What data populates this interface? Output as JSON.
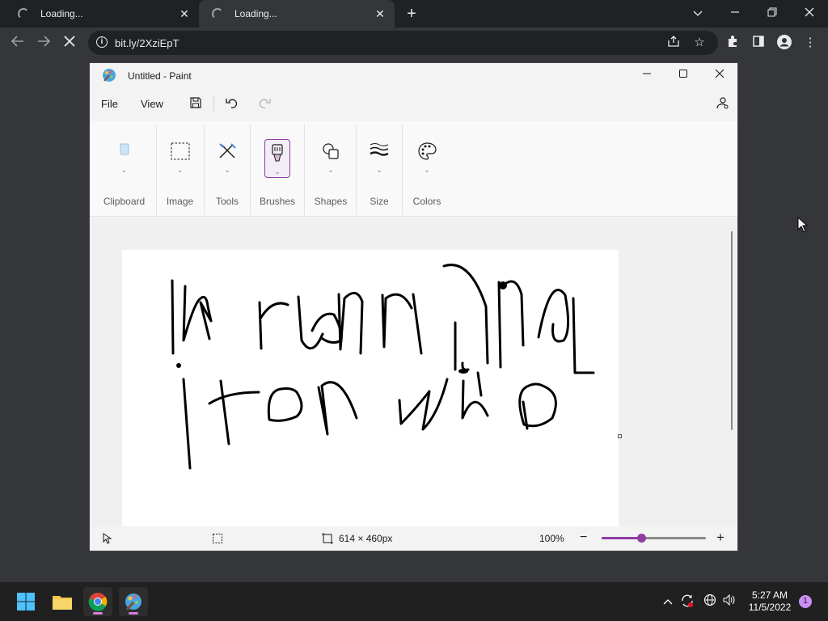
{
  "browser": {
    "tabs": [
      {
        "title": "Loading...",
        "active": false
      },
      {
        "title": "Loading...",
        "active": true
      }
    ],
    "url": "bit.ly/2XziEpT",
    "info_icon": "i"
  },
  "paint": {
    "title": "Untitled - Paint",
    "menu": {
      "file": "File",
      "view": "View"
    },
    "ribbon_groups": [
      "Clipboard",
      "Image",
      "Tools",
      "Brushes",
      "Shapes",
      "Size",
      "Colors"
    ],
    "status": {
      "canvas_size": "614 × 460px",
      "zoom": "100%",
      "zoom_level": 0.38
    },
    "drawing_text": [
      "running",
      "ton who"
    ]
  },
  "taskbar": {
    "time": "5:27 AM",
    "date": "11/5/2022",
    "notifications": "1",
    "pinned": [
      "start-icon",
      "file-explorer-icon",
      "chrome-icon",
      "paint-icon"
    ]
  },
  "colors": {
    "chrome_dark": "#202124",
    "chrome_toolbar": "#35363a",
    "paint_accent": "#8e3ea0",
    "taskbar": "#202020"
  }
}
